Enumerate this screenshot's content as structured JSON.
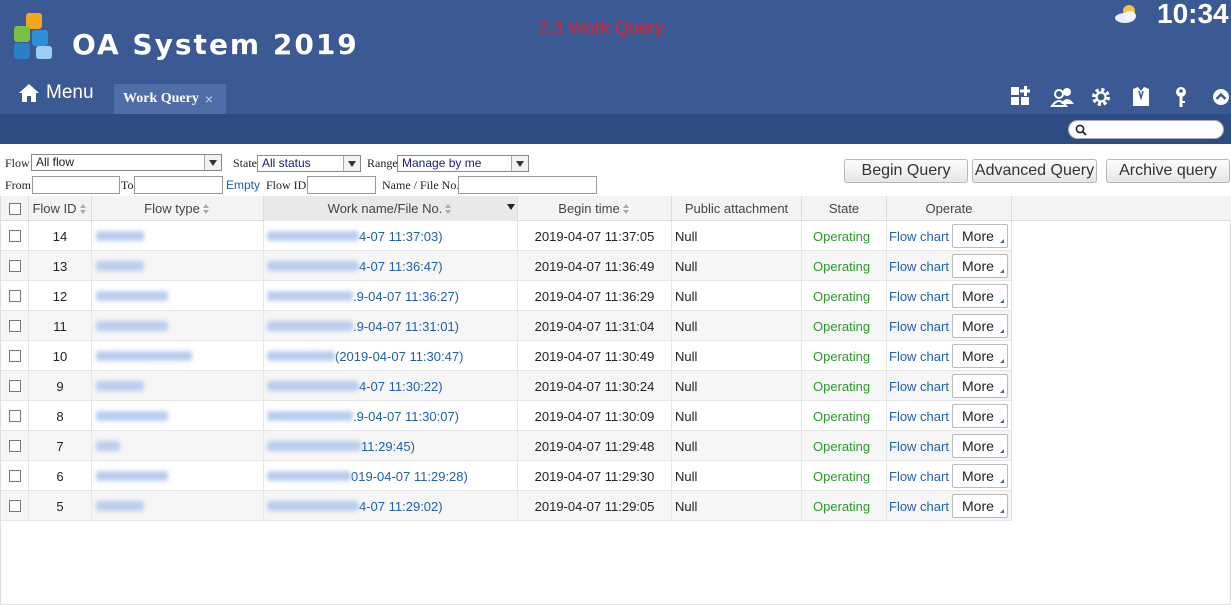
{
  "header": {
    "app_title": "OA System 2019",
    "page_caption": "2.3 Work Query",
    "time": "10:34",
    "weather_icon": "partly-cloudy-icon",
    "menu_label": "Menu",
    "active_tab": "Work Query",
    "tab_close": "×",
    "tool_icons": [
      "add-grid-icon",
      "users-icon",
      "settings-icon",
      "shirt-icon",
      "key-icon",
      "collapse-up-icon"
    ]
  },
  "filters": {
    "flow_label": "Flow",
    "flow_value": "All flow",
    "state_label": "State",
    "state_value": "All status",
    "range_label": "Range",
    "range_value": "Manage by me",
    "from_label": "From",
    "to_label": "To",
    "empty_link": "Empty",
    "flow_id_label": "Flow ID",
    "name_file_label": "Name / File No.",
    "begin_query": "Begin Query",
    "advanced_query": "Advanced Query",
    "archive_query": "Archive query"
  },
  "table": {
    "columns": [
      "Flow ID",
      "Flow type",
      "Work name/File No.",
      "Begin time",
      "Public attachment",
      "State",
      "Operate"
    ],
    "rows": [
      {
        "id": "14",
        "name_suffix": "4-07 11:37:03)",
        "begin": "2019-04-07 11:37:05",
        "attach": "Null",
        "state": "Operating",
        "flow": "Flow chart",
        "more": "More"
      },
      {
        "id": "13",
        "name_suffix": "4-07 11:36:47)",
        "begin": "2019-04-07 11:36:49",
        "attach": "Null",
        "state": "Operating",
        "flow": "Flow chart",
        "more": "More"
      },
      {
        "id": "12",
        "name_suffix": ".9-04-07 11:36:27)",
        "begin": "2019-04-07 11:36:29",
        "attach": "Null",
        "state": "Operating",
        "flow": "Flow chart",
        "more": "More"
      },
      {
        "id": "11",
        "name_suffix": ".9-04-07 11:31:01)",
        "begin": "2019-04-07 11:31:04",
        "attach": "Null",
        "state": "Operating",
        "flow": "Flow chart",
        "more": "More"
      },
      {
        "id": "10",
        "name_suffix": "(2019-04-07 11:30:47)",
        "begin": "2019-04-07 11:30:49",
        "attach": "Null",
        "state": "Operating",
        "flow": "Flow chart",
        "more": "More"
      },
      {
        "id": "9",
        "name_suffix": "4-07 11:30:22)",
        "begin": "2019-04-07 11:30:24",
        "attach": "Null",
        "state": "Operating",
        "flow": "Flow chart",
        "more": "More"
      },
      {
        "id": "8",
        "name_suffix": ".9-04-07 11:30:07)",
        "begin": "2019-04-07 11:30:09",
        "attach": "Null",
        "state": "Operating",
        "flow": "Flow chart",
        "more": "More"
      },
      {
        "id": "7",
        "name_suffix": " 11:29:45)",
        "begin": "2019-04-07 11:29:48",
        "attach": "Null",
        "state": "Operating",
        "flow": "Flow chart",
        "more": "More"
      },
      {
        "id": "6",
        "name_suffix": "019-04-07 11:29:28)",
        "begin": "2019-04-07 11:29:30",
        "attach": "Null",
        "state": "Operating",
        "flow": "Flow chart",
        "more": "More"
      },
      {
        "id": "5",
        "name_suffix": "4-07 11:29:02)",
        "begin": "2019-04-07 11:29:05",
        "attach": "Null",
        "state": "Operating",
        "flow": "Flow chart",
        "more": "More"
      }
    ]
  }
}
